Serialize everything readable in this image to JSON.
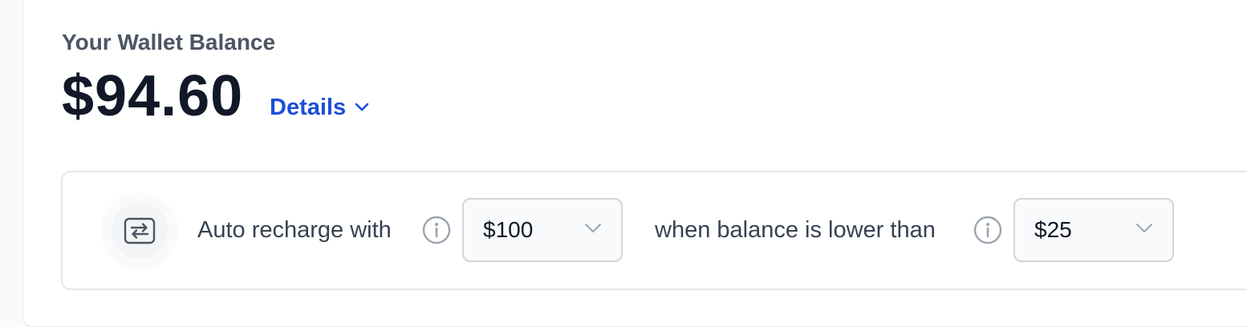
{
  "wallet": {
    "label": "Your Wallet Balance",
    "amount": "$94.60",
    "details_label": "Details",
    "details_icon": "chevron-down-icon",
    "accent_color": "#1d4ed8"
  },
  "auto_recharge": {
    "icon": "recharge-icon",
    "label": "Auto recharge with",
    "info_icon": "info-icon",
    "amount_select": {
      "value": "$100"
    },
    "threshold_label": "when balance is lower than",
    "threshold_select": {
      "value": "$25"
    }
  }
}
